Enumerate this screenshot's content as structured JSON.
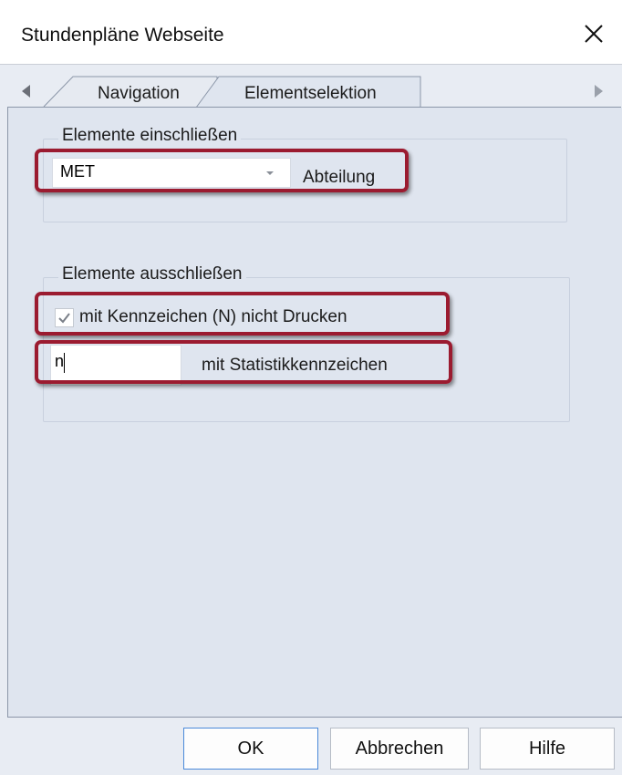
{
  "window": {
    "title": "Stundenpläne Webseite",
    "close_icon": "close-icon"
  },
  "tabs": [
    {
      "label": "Navigation",
      "active": false
    },
    {
      "label": "Elementselektion",
      "active": true
    }
  ],
  "tab_scroll": {
    "left_icon": "chevron-left-icon",
    "right_icon": "chevron-right-icon"
  },
  "include_group": {
    "title": "Elemente einschließen",
    "combo_value": "MET",
    "combo_label": "Abteilung"
  },
  "exclude_group": {
    "title": "Elemente ausschließen",
    "checkbox_label": "mit Kennzeichen (N) nicht Drucken",
    "checkbox_checked": true,
    "textbox_value": "n",
    "textbox_label": "mit Statistikkennzeichen"
  },
  "highlight_color": "#9b1b30",
  "buttons": {
    "ok": "OK",
    "cancel": "Abbrechen",
    "help": "Hilfe"
  }
}
